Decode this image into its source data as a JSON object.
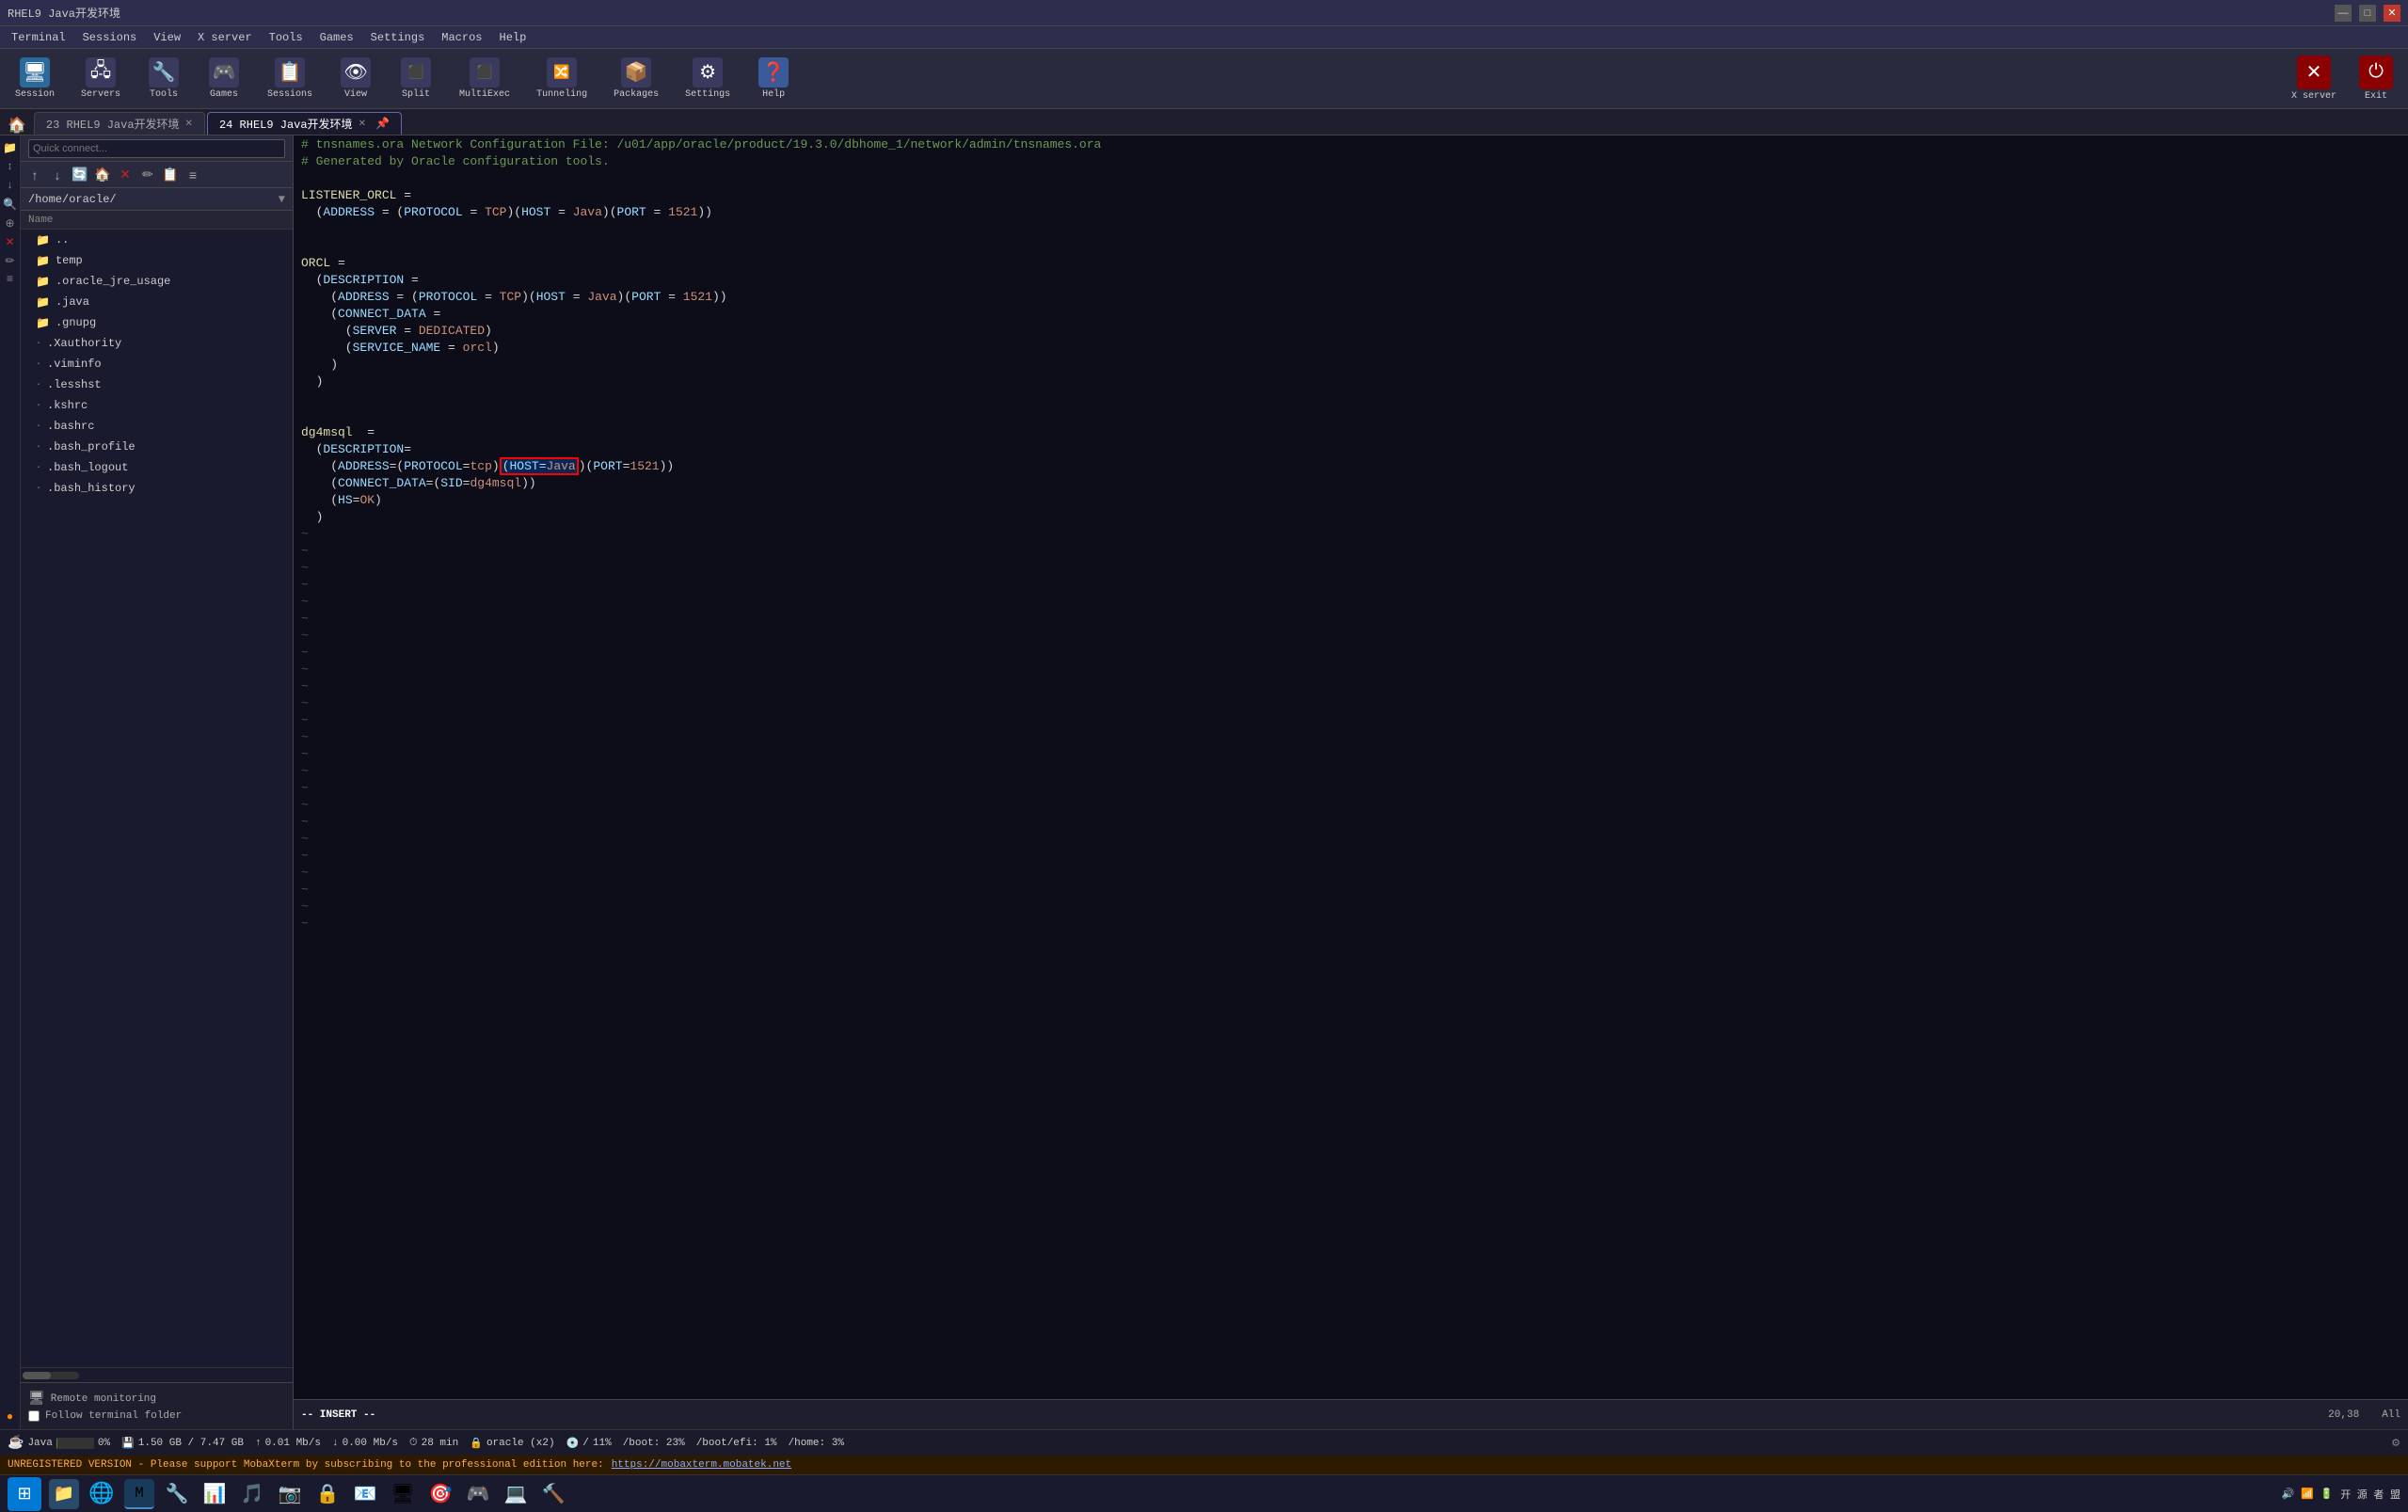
{
  "window": {
    "title": "RHEL9 Java开发环境",
    "controls": [
      "minimize",
      "maximize",
      "close"
    ]
  },
  "menubar": {
    "items": [
      "Terminal",
      "Sessions",
      "View",
      "X server",
      "Tools",
      "Games",
      "Settings",
      "Macros",
      "Help"
    ]
  },
  "toolbar": {
    "items": [
      {
        "icon": "🖥",
        "label": "Session"
      },
      {
        "icon": "🖧",
        "label": "Servers"
      },
      {
        "icon": "🔧",
        "label": "Tools"
      },
      {
        "icon": "🎮",
        "label": "Games"
      },
      {
        "icon": "📋",
        "label": "Sessions"
      },
      {
        "icon": "👁",
        "label": "View"
      },
      {
        "icon": "⬛",
        "label": "Split"
      },
      {
        "icon": "⬛",
        "label": "MultiExec"
      },
      {
        "icon": "⬛",
        "label": "Tunneling"
      },
      {
        "icon": "📦",
        "label": "Packages"
      },
      {
        "icon": "⚙",
        "label": "Settings"
      },
      {
        "icon": "❓",
        "label": "Help"
      }
    ],
    "x_server_label": "X server",
    "exit_label": "Exit"
  },
  "tabs": [
    {
      "id": "tab1",
      "label": "23  RHEL9 Java开发环境",
      "active": false
    },
    {
      "id": "tab2",
      "label": "24  RHEL9 Java开发环境",
      "active": true
    }
  ],
  "sidebar": {
    "path": "/home/oracle/",
    "header": "Name",
    "quick_connect_placeholder": "Quick connect...",
    "files": [
      {
        "name": "..",
        "type": "folder",
        "icon": "📁"
      },
      {
        "name": "temp",
        "type": "folder",
        "icon": "📁"
      },
      {
        "name": ".oracle_jre_usage",
        "type": "folder",
        "icon": "📁"
      },
      {
        "name": ".java",
        "type": "folder",
        "icon": "📁"
      },
      {
        "name": ".gnupg",
        "type": "folder",
        "icon": "📁"
      },
      {
        "name": ".Xauthority",
        "type": "file",
        "icon": "·"
      },
      {
        "name": ".viminfo",
        "type": "file",
        "icon": "·"
      },
      {
        "name": ".lesshst",
        "type": "file",
        "icon": "·"
      },
      {
        "name": ".kshrc",
        "type": "file",
        "icon": "·"
      },
      {
        "name": ".bashrc",
        "type": "file",
        "icon": "·"
      },
      {
        "name": ".bash_profile",
        "type": "file",
        "icon": "·"
      },
      {
        "name": ".bash_logout",
        "type": "file",
        "icon": "·"
      },
      {
        "name": ".bash_history",
        "type": "file",
        "icon": "·"
      }
    ],
    "remote_monitoring": "Remote monitoring",
    "follow_terminal": "Follow terminal folder"
  },
  "editor": {
    "lines": [
      {
        "num": "",
        "content": "comment1"
      },
      {
        "num": "",
        "content": "comment2"
      },
      {
        "num": "",
        "content": ""
      },
      {
        "num": "",
        "content": "LISTENER_ORCL ="
      },
      {
        "num": "",
        "content": "  (ADDRESS = (PROTOCOL = TCP)(HOST = Java)(PORT = 1521))"
      },
      {
        "num": "",
        "content": ""
      },
      {
        "num": "",
        "content": ""
      },
      {
        "num": "",
        "content": "ORCL ="
      },
      {
        "num": "",
        "content": "  (DESCRIPTION ="
      },
      {
        "num": "",
        "content": "    (ADDRESS = (PROTOCOL = TCP)(HOST = Java)(PORT = 1521))"
      },
      {
        "num": "",
        "content": "    (CONNECT_DATA ="
      },
      {
        "num": "",
        "content": "      (SERVER = DEDICATED)"
      },
      {
        "num": "",
        "content": "      (SERVICE_NAME = orcl)"
      },
      {
        "num": "",
        "content": "    )"
      },
      {
        "num": "",
        "content": "  )"
      },
      {
        "num": "",
        "content": ""
      },
      {
        "num": "",
        "content": ""
      },
      {
        "num": "",
        "content": "dg4msql  ="
      },
      {
        "num": "",
        "content": "  (DESCRIPTION="
      },
      {
        "num": "",
        "content": "    (ADDRESS=(PROTOCOL=tcp)(HOST=Java)(PORT=1521))"
      },
      {
        "num": "",
        "content": "    (CONNECT_DATA=(SID=dg4msql))"
      },
      {
        "num": "",
        "content": "    (HS=OK)"
      },
      {
        "num": "",
        "content": "  )"
      }
    ],
    "comment1": "# tnsnames.ora Network Configuration File: /u01/app/oracle/product/19.3.0/dbhome_1/network/admin/tnsnames.ora",
    "comment2": "# Generated by Oracle configuration tools.",
    "status_mode": "-- INSERT --",
    "cursor_pos": "20,38",
    "scroll_pos": "All"
  },
  "bottom_toolbar": {
    "java_label": "Java",
    "cpu_pct": "0%",
    "memory": "1.50 GB / 7.47 GB",
    "upload": "0.01 Mb/s",
    "download": "0.00 Mb/s",
    "time": "28 min",
    "oracle_label": "oracle (x2)",
    "disk_slash": "/",
    "disk_slash_pct": "11%",
    "boot_pct": "/boot: 23%",
    "boot_efi_pct": "/boot/efi: 1%",
    "home_pct": "/home: 3%"
  },
  "bottom_status": {
    "text": "UNREGISTERED VERSION  -  Please support MobaXterm by subscribing to the professional edition here:",
    "link": "https://mobaxterm.mobatek.net"
  },
  "taskbar": {
    "time": "开 源 者 盟",
    "icons": [
      "⊞",
      "三",
      "🌐",
      "📁",
      "🔧",
      "⚙",
      "🎵",
      "📷",
      "🔒",
      "📧",
      "🖥",
      "📊",
      "🎯",
      "🎮",
      "💻",
      "🔨"
    ]
  }
}
